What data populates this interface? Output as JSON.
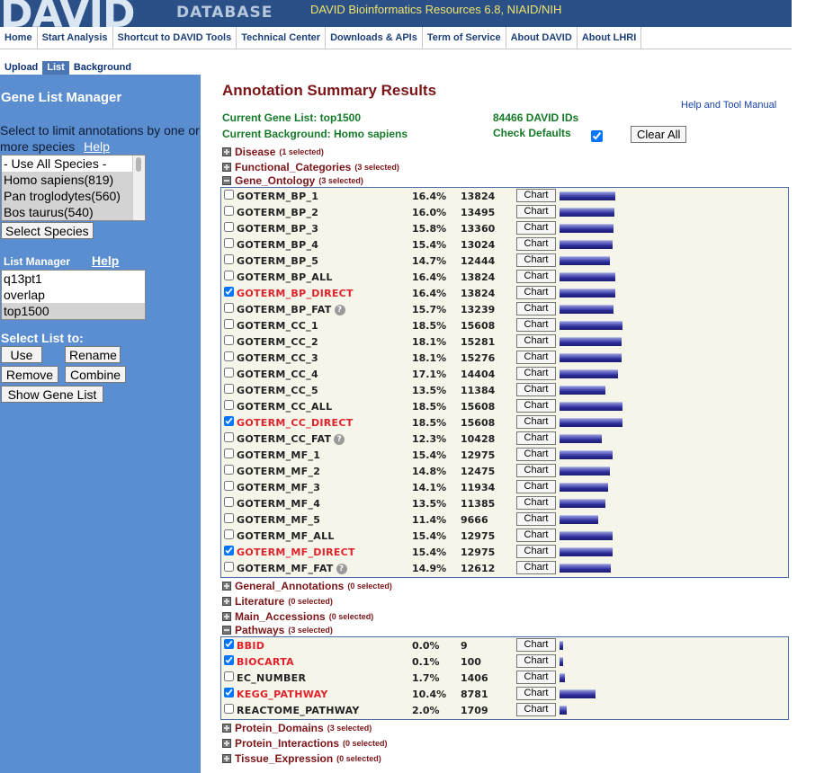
{
  "banner": {
    "logo_text": "DAVID",
    "logo_sub": "DATABASE",
    "site_title": "DAVID Bioinformatics Resources 6.8, NIAID/NIH"
  },
  "topnav": [
    "Home",
    "Start Analysis",
    "Shortcut to DAVID Tools",
    "Technical Center",
    "Downloads & APIs",
    "Term of Service",
    "About DAVID",
    "About LHRI"
  ],
  "subnav": {
    "upload": "Upload",
    "list": "List",
    "background": "Background"
  },
  "sidebar": {
    "title": "Gene List Manager",
    "species_desc": "Select to limit annotations by one or more species",
    "help_label": "Help",
    "species_options": [
      {
        "label": "- Use All Species -",
        "selected": false
      },
      {
        "label": "Homo sapiens(819)",
        "selected": true
      },
      {
        "label": "Pan troglodytes(560)",
        "selected": true
      },
      {
        "label": "Bos taurus(540)",
        "selected": true
      }
    ],
    "select_species_label": "Select Species",
    "list_manager_label": "List Manager",
    "list_manager_help": "Help",
    "lists": [
      {
        "label": "q13pt1",
        "selected": false
      },
      {
        "label": "overlap",
        "selected": false
      },
      {
        "label": "top1500",
        "selected": true
      }
    ],
    "select_list_to": "Select List to:",
    "use_label": "Use",
    "rename_label": "Rename",
    "remove_label": "Remove",
    "combine_label": "Combine",
    "show_gene_list_label": "Show Gene List"
  },
  "main": {
    "title": "Annotation Summary Results",
    "help_manual": "Help and Tool Manual",
    "current_gene_list": "Current Gene List: top1500",
    "david_ids": "84466 DAVID IDs",
    "current_background": "Current Background: Homo sapiens",
    "check_defaults": "Check Defaults",
    "check_defaults_checked": true,
    "clear_all": "Clear All",
    "chart_label": "Chart",
    "categories": {
      "disease": {
        "name": "Disease",
        "selected": "(1 selected)"
      },
      "functional": {
        "name": "Functional_Categories",
        "selected": "(3 selected)"
      },
      "go": {
        "name": "Gene_Ontology",
        "selected": "(3 selected)"
      },
      "general": {
        "name": "General_Annotations",
        "selected": "(0 selected)"
      },
      "literature": {
        "name": "Literature",
        "selected": "(0 selected)"
      },
      "main_acc": {
        "name": "Main_Accessions",
        "selected": "(0 selected)"
      },
      "pathways": {
        "name": "Pathways",
        "selected": "(3 selected)"
      },
      "protein_domains": {
        "name": "Protein_Domains",
        "selected": "(3 selected)"
      },
      "protein_interactions": {
        "name": "Protein_Interactions",
        "selected": "(0 selected)"
      },
      "tissue": {
        "name": "Tissue_Expression",
        "selected": "(0 selected)"
      }
    },
    "go_rows": [
      {
        "term": "GOTERM_BP_1",
        "pct": "16.4%",
        "count": "13824",
        "checked": false,
        "help": false,
        "fraction": 0.164
      },
      {
        "term": "GOTERM_BP_2",
        "pct": "16.0%",
        "count": "13495",
        "checked": false,
        "help": false,
        "fraction": 0.16
      },
      {
        "term": "GOTERM_BP_3",
        "pct": "15.8%",
        "count": "13360",
        "checked": false,
        "help": false,
        "fraction": 0.158
      },
      {
        "term": "GOTERM_BP_4",
        "pct": "15.4%",
        "count": "13024",
        "checked": false,
        "help": false,
        "fraction": 0.154
      },
      {
        "term": "GOTERM_BP_5",
        "pct": "14.7%",
        "count": "12444",
        "checked": false,
        "help": false,
        "fraction": 0.147
      },
      {
        "term": "GOTERM_BP_ALL",
        "pct": "16.4%",
        "count": "13824",
        "checked": false,
        "help": false,
        "fraction": 0.164
      },
      {
        "term": "GOTERM_BP_DIRECT",
        "pct": "16.4%",
        "count": "13824",
        "checked": true,
        "help": false,
        "fraction": 0.164
      },
      {
        "term": "GOTERM_BP_FAT",
        "pct": "15.7%",
        "count": "13239",
        "checked": false,
        "help": true,
        "fraction": 0.157
      },
      {
        "term": "GOTERM_CC_1",
        "pct": "18.5%",
        "count": "15608",
        "checked": false,
        "help": false,
        "fraction": 0.185
      },
      {
        "term": "GOTERM_CC_2",
        "pct": "18.1%",
        "count": "15281",
        "checked": false,
        "help": false,
        "fraction": 0.181
      },
      {
        "term": "GOTERM_CC_3",
        "pct": "18.1%",
        "count": "15276",
        "checked": false,
        "help": false,
        "fraction": 0.181
      },
      {
        "term": "GOTERM_CC_4",
        "pct": "17.1%",
        "count": "14404",
        "checked": false,
        "help": false,
        "fraction": 0.171
      },
      {
        "term": "GOTERM_CC_5",
        "pct": "13.5%",
        "count": "11384",
        "checked": false,
        "help": false,
        "fraction": 0.135
      },
      {
        "term": "GOTERM_CC_ALL",
        "pct": "18.5%",
        "count": "15608",
        "checked": false,
        "help": false,
        "fraction": 0.185
      },
      {
        "term": "GOTERM_CC_DIRECT",
        "pct": "18.5%",
        "count": "15608",
        "checked": true,
        "help": false,
        "fraction": 0.185
      },
      {
        "term": "GOTERM_CC_FAT",
        "pct": "12.3%",
        "count": "10428",
        "checked": false,
        "help": true,
        "fraction": 0.123
      },
      {
        "term": "GOTERM_MF_1",
        "pct": "15.4%",
        "count": "12975",
        "checked": false,
        "help": false,
        "fraction": 0.154
      },
      {
        "term": "GOTERM_MF_2",
        "pct": "14.8%",
        "count": "12475",
        "checked": false,
        "help": false,
        "fraction": 0.148
      },
      {
        "term": "GOTERM_MF_3",
        "pct": "14.1%",
        "count": "11934",
        "checked": false,
        "help": false,
        "fraction": 0.141
      },
      {
        "term": "GOTERM_MF_4",
        "pct": "13.5%",
        "count": "11385",
        "checked": false,
        "help": false,
        "fraction": 0.135
      },
      {
        "term": "GOTERM_MF_5",
        "pct": "11.4%",
        "count": "9666",
        "checked": false,
        "help": false,
        "fraction": 0.114
      },
      {
        "term": "GOTERM_MF_ALL",
        "pct": "15.4%",
        "count": "12975",
        "checked": false,
        "help": false,
        "fraction": 0.154
      },
      {
        "term": "GOTERM_MF_DIRECT",
        "pct": "15.4%",
        "count": "12975",
        "checked": true,
        "help": false,
        "fraction": 0.154
      },
      {
        "term": "GOTERM_MF_FAT",
        "pct": "14.9%",
        "count": "12612",
        "checked": false,
        "help": true,
        "fraction": 0.149
      }
    ],
    "pathway_rows": [
      {
        "term": "BBID",
        "pct": "0.0%",
        "count": "9",
        "checked": true,
        "help": false,
        "fraction": 0.0
      },
      {
        "term": "BIOCARTA",
        "pct": "0.1%",
        "count": "100",
        "checked": true,
        "help": false,
        "fraction": 0.001
      },
      {
        "term": "EC_NUMBER",
        "pct": "1.7%",
        "count": "1406",
        "checked": false,
        "help": false,
        "fraction": 0.017
      },
      {
        "term": "KEGG_PATHWAY",
        "pct": "10.4%",
        "count": "8781",
        "checked": true,
        "help": false,
        "fraction": 0.104
      },
      {
        "term": "REACTOME_PATHWAY",
        "pct": "2.0%",
        "count": "1709",
        "checked": false,
        "help": false,
        "fraction": 0.02
      }
    ],
    "colors": {
      "checked_term": "#e0222a",
      "category": "#7b1518",
      "info": "#157a27",
      "sidebar": "#5b8ed0",
      "banner": "#2b4f87"
    }
  }
}
